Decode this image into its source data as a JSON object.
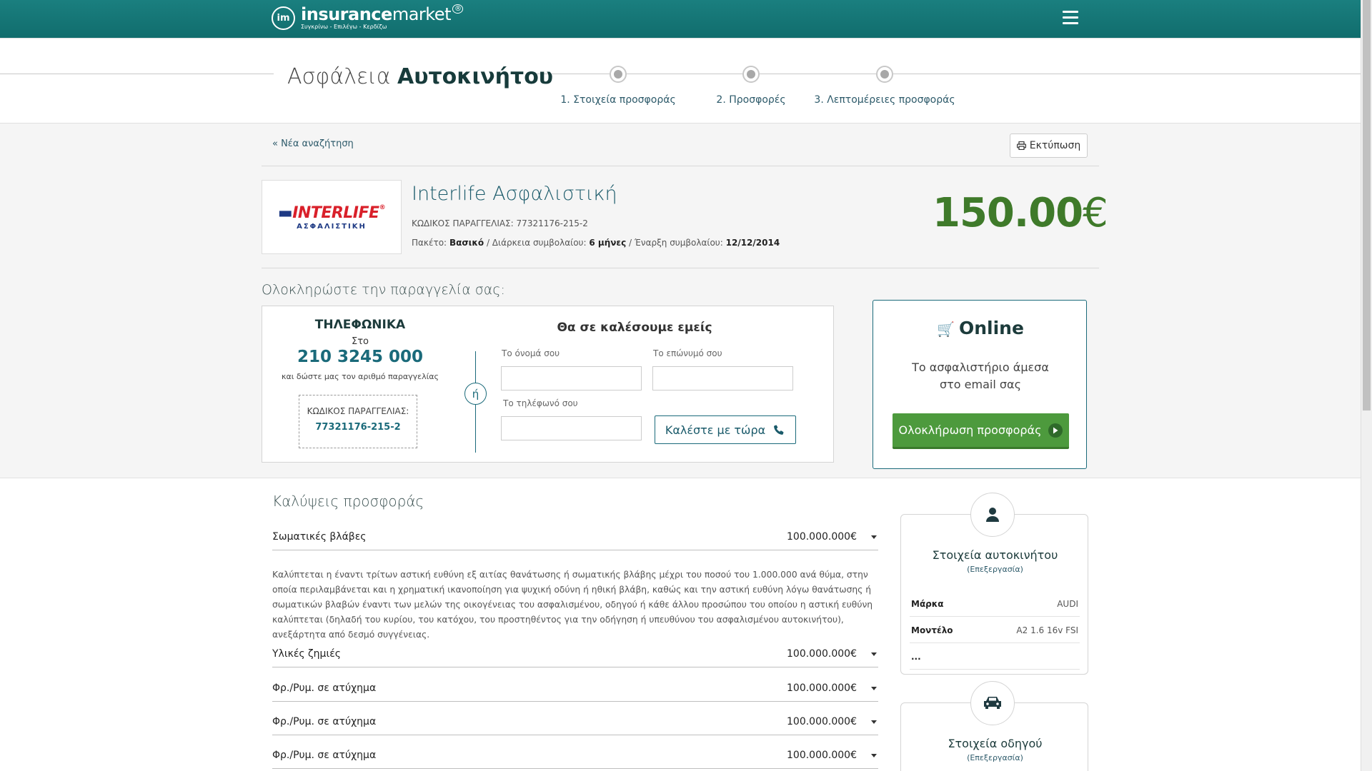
{
  "header": {
    "logo_mark": "im",
    "logo_word_bold": "insurance",
    "logo_word_light": "market",
    "logo_reg": "®",
    "logo_tagline": "Συγκρίνω - Επιλέγω - Κερδίζω"
  },
  "steps": {
    "heading_light": "Ασφάλεια",
    "heading_bold": "Αυτοκινήτου",
    "items": [
      {
        "label": "1. Στοιχεία προσφοράς"
      },
      {
        "label": "2. Προσφορές"
      },
      {
        "label": "3. Λεπτομέρειες προσφοράς"
      }
    ]
  },
  "offer": {
    "new_search": "« Νέα αναζήτηση",
    "print_label": "Εκτύπωση",
    "insurer_logo_text": "INTERLIFE",
    "insurer_logo_sub": "ΑΣΦΑΛΙΣΤΙΚΗ",
    "company_name": "Interlife Ασφαλιστική",
    "order_code_label": "ΚΩΔΙΚΟΣ ΠΑΡΑΓΓΕΛΙΑΣ:",
    "order_code": "77321176-215-2",
    "package_label": "Πακέτο:",
    "package_value": "Βασικό",
    "duration_label": "Διάρκεια συμβολαίου:",
    "duration_value": "6 μήνες",
    "start_label": "Έναρξη συμβολαίου:",
    "start_value": "12/12/2014",
    "price": "150.00",
    "currency": "€"
  },
  "complete": {
    "title": "Ολοκληρώστε την παραγγελία σας:",
    "phone": {
      "heading": "ΤΗΛΕΦΩΝΙΚΑ",
      "sto": "Στο",
      "number": "210 3245 000",
      "give": "και δώστε μας τον αριθμό παραγγελίας",
      "code_label": "ΚΩΔΙΚΟΣ ΠΑΡΑΓΓΕΛΙΑΣ:",
      "code_value": "77321176-215-2"
    },
    "or_label": "ή",
    "callback": {
      "heading": "Θα σε καλέσουμε εμείς",
      "first_name_label": "Το όνομά σου",
      "first_name_value": "",
      "last_name_label": "Το επώνυμό  σου",
      "last_name_value": "",
      "phone_label": "Το τηλέφωνό σου",
      "phone_value": "",
      "call_button": "Καλέστε με τώρα"
    },
    "online": {
      "heading": "Online",
      "desc_line1": "Το ασφαλιστήριο άμεσα",
      "desc_line2": "στο email σας",
      "button": "Ολοκλήρωση προσφοράς"
    }
  },
  "coverages": {
    "title": "Καλύψεις προσφοράς",
    "items": [
      {
        "name": "Σωματικές βλάβες",
        "value": "100.000.000€"
      },
      {
        "name": "Υλικές ζημιές",
        "value": "100.000.000€"
      },
      {
        "name": "Φρ./Ρυμ. σε ατύχημα",
        "value": "100.000.000€"
      },
      {
        "name": "Φρ./Ρυμ. σε ατύχημα",
        "value": "100.000.000€"
      },
      {
        "name": "Φρ./Ρυμ. σε ατύχημα",
        "value": "100.000.000€"
      }
    ],
    "first_description": "Καλύπτεται η έναντι τρίτων αστική ευθύνη εξ αιτίας θανάτωσης ή σωματικής βλάβης μέχρι του ποσού του 1.000.000 ανά θύμα, στην οποία περιλαμβάνεται και η χρηματική ικανοποίηση για ψυχική οδύνη ή ηθική βλάβη, καθώς και την αστική ευθύνη λόγω θανάτωσης ή σωματικών βλαβών έναντι των μελών της οικογένειας του ασφαλισμένου, οδηγού ή κάθε άλλου προσώπου του οποίου η αστική ευθύνη καλύπτεται (δηλαδή του κυρίου, του κατόχου, του προστηθέντος για την οδήγηση ή υπευθύνου του ασφαλισμένου αυτοκινήτου), ανεξάρτητα από δεσμό συγγένειας."
  },
  "vehicle_card": {
    "title": "Στοιχεία αυτοκινήτου",
    "edit": "(Επεξεργασία)",
    "rows": [
      {
        "key": "Μάρκα",
        "value": "AUDI"
      },
      {
        "key": "Μοντέλο",
        "value": "A2 1.6 16v FSI"
      },
      {
        "key": "...",
        "value": ""
      }
    ]
  },
  "driver_card": {
    "title": "Στοιχεία οδηγού",
    "edit": "(Επεξεργασία)"
  },
  "colors": {
    "header_teal": "#147676",
    "price_green": "#3f7a2a",
    "button_green": "#4d9a3d",
    "link_teal": "#1a6a7a"
  }
}
